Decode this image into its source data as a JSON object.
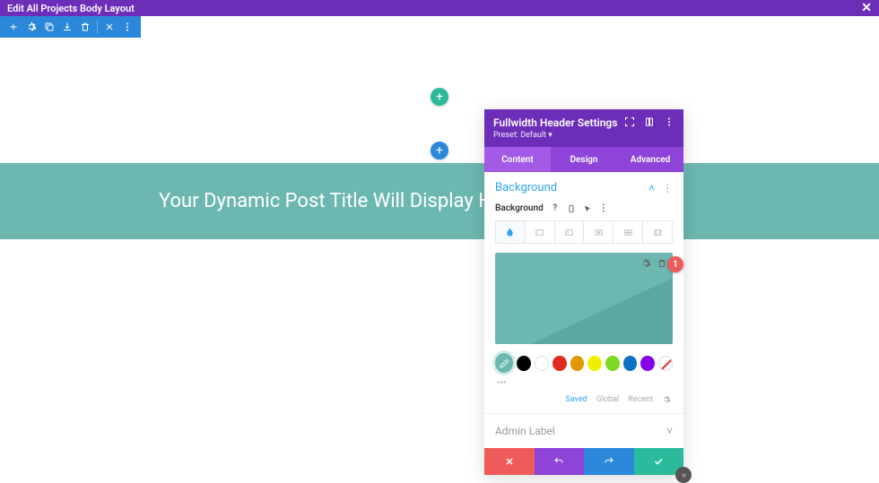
{
  "topbar": {
    "title": "Edit All Projects Body Layout"
  },
  "hero": {
    "title": "Your Dynamic Post Title Will Display Here"
  },
  "panel": {
    "title": "Fullwidth Header Settings",
    "preset": "Preset: Default ▾",
    "tabs": {
      "content": "Content",
      "design": "Design",
      "advanced": "Advanced"
    },
    "section": {
      "title": "Background",
      "label": "Background"
    },
    "callout": "1",
    "color_tabs": {
      "saved": "Saved",
      "global": "Global",
      "recent": "Recent"
    },
    "admin_label": "Admin Label"
  },
  "colors": {
    "teal": "#6cb8b0"
  }
}
